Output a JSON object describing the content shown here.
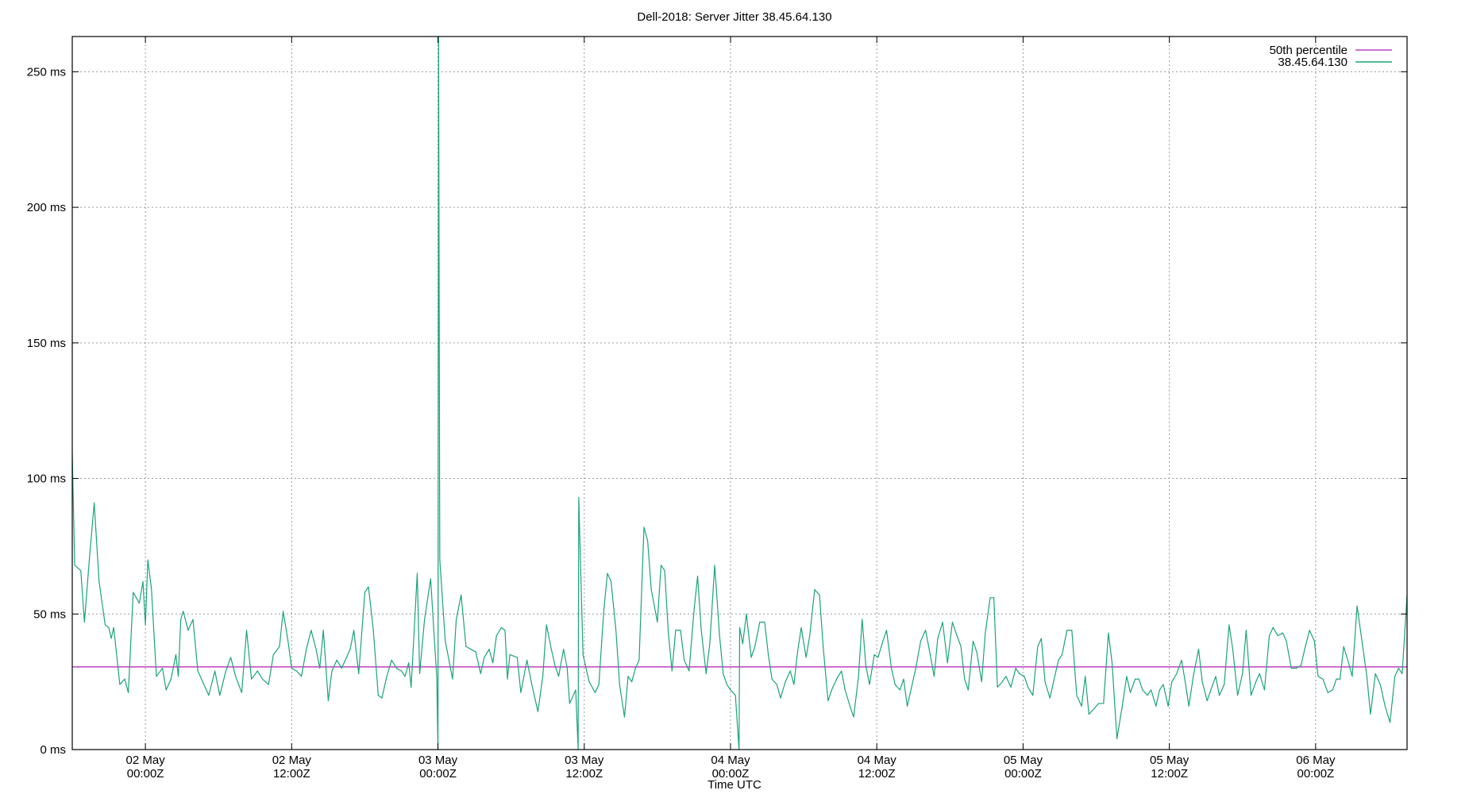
{
  "chart_data": {
    "type": "line",
    "title": "Dell-2018: Server Jitter 38.45.64.130",
    "xlabel": "Time UTC",
    "ylabel": "",
    "grid": true,
    "legend_position": "top-right",
    "x_unit": "hours since 01 May 18:00Z",
    "xlim": [
      0,
      109.5
    ],
    "ylim": [
      0,
      263
    ],
    "y_ticks": [
      {
        "value": 0,
        "label": "0 ms"
      },
      {
        "value": 50,
        "label": "50 ms"
      },
      {
        "value": 100,
        "label": "100 ms"
      },
      {
        "value": 150,
        "label": "150 ms"
      },
      {
        "value": 200,
        "label": "200 ms"
      },
      {
        "value": 250,
        "label": "250 ms"
      }
    ],
    "x_ticks": [
      {
        "value": 6,
        "line1": "02 May",
        "line2": "00:00Z"
      },
      {
        "value": 18,
        "line1": "02 May",
        "line2": "12:00Z"
      },
      {
        "value": 30,
        "line1": "03 May",
        "line2": "00:00Z"
      },
      {
        "value": 42,
        "line1": "03 May",
        "line2": "12:00Z"
      },
      {
        "value": 54,
        "line1": "04 May",
        "line2": "00:00Z"
      },
      {
        "value": 66,
        "line1": "04 May",
        "line2": "12:00Z"
      },
      {
        "value": 78,
        "line1": "05 May",
        "line2": "00:00Z"
      },
      {
        "value": 90,
        "line1": "05 May",
        "line2": "12:00Z"
      },
      {
        "value": 102,
        "line1": "06 May",
        "line2": "00:00Z"
      }
    ],
    "series": [
      {
        "name": "50th percentile",
        "color": "#c040c0",
        "kind": "hline",
        "value": 30.5
      },
      {
        "name": "38.45.64.130",
        "color": "#1aa37a",
        "kind": "line",
        "points": [
          [
            0.0,
            109
          ],
          [
            0.2,
            68
          ],
          [
            0.7,
            66
          ],
          [
            1.0,
            47
          ],
          [
            1.4,
            70
          ],
          [
            1.8,
            91
          ],
          [
            2.2,
            62
          ],
          [
            2.7,
            46
          ],
          [
            3.0,
            45
          ],
          [
            3.2,
            41
          ],
          [
            3.4,
            45
          ],
          [
            3.9,
            24
          ],
          [
            4.3,
            26
          ],
          [
            4.6,
            21
          ],
          [
            5.0,
            58
          ],
          [
            5.5,
            54
          ],
          [
            5.8,
            62
          ],
          [
            6.0,
            46
          ],
          [
            6.2,
            70
          ],
          [
            6.5,
            59
          ],
          [
            6.9,
            27
          ],
          [
            7.4,
            30
          ],
          [
            7.7,
            22
          ],
          [
            8.1,
            26
          ],
          [
            8.5,
            35
          ],
          [
            8.7,
            27
          ],
          [
            8.9,
            48
          ],
          [
            9.1,
            51
          ],
          [
            9.5,
            44
          ],
          [
            9.9,
            48
          ],
          [
            10.3,
            29
          ],
          [
            10.8,
            24
          ],
          [
            11.2,
            20
          ],
          [
            11.7,
            29
          ],
          [
            12.1,
            20
          ],
          [
            12.6,
            29
          ],
          [
            13.0,
            34
          ],
          [
            13.4,
            27
          ],
          [
            13.9,
            21
          ],
          [
            14.3,
            44
          ],
          [
            14.7,
            26
          ],
          [
            15.2,
            29
          ],
          [
            15.6,
            26
          ],
          [
            16.1,
            24
          ],
          [
            16.5,
            35
          ],
          [
            17.0,
            38
          ],
          [
            17.3,
            51
          ],
          [
            17.7,
            40
          ],
          [
            18.0,
            30
          ],
          [
            18.4,
            29
          ],
          [
            18.8,
            27
          ],
          [
            19.2,
            37
          ],
          [
            19.6,
            44
          ],
          [
            20.0,
            37
          ],
          [
            20.3,
            30
          ],
          [
            20.6,
            44
          ],
          [
            21.0,
            18
          ],
          [
            21.3,
            29
          ],
          [
            21.7,
            33
          ],
          [
            22.1,
            30
          ],
          [
            22.5,
            34
          ],
          [
            22.8,
            37
          ],
          [
            23.1,
            44
          ],
          [
            23.5,
            28
          ],
          [
            24.0,
            58
          ],
          [
            24.3,
            60
          ],
          [
            24.7,
            44
          ],
          [
            25.1,
            20
          ],
          [
            25.4,
            19
          ],
          [
            25.8,
            27
          ],
          [
            26.2,
            33
          ],
          [
            26.6,
            30
          ],
          [
            27.0,
            29
          ],
          [
            27.3,
            27
          ],
          [
            27.6,
            32
          ],
          [
            27.8,
            23
          ],
          [
            28.3,
            65
          ],
          [
            28.5,
            28
          ],
          [
            28.9,
            48
          ],
          [
            29.4,
            63
          ],
          [
            29.7,
            41
          ],
          [
            29.9,
            27
          ],
          [
            30.0,
            0
          ],
          [
            30.05,
            263
          ],
          [
            30.15,
            70
          ],
          [
            30.6,
            40
          ],
          [
            31.2,
            26
          ],
          [
            31.5,
            48
          ],
          [
            31.9,
            57
          ],
          [
            32.3,
            38
          ],
          [
            32.7,
            37
          ],
          [
            33.1,
            36
          ],
          [
            33.5,
            28
          ],
          [
            33.8,
            34
          ],
          [
            34.2,
            37
          ],
          [
            34.5,
            32
          ],
          [
            34.8,
            42
          ],
          [
            35.2,
            45
          ],
          [
            35.5,
            44
          ],
          [
            35.7,
            26
          ],
          [
            35.9,
            35
          ],
          [
            36.5,
            34
          ],
          [
            36.8,
            21
          ],
          [
            37.3,
            33
          ],
          [
            37.7,
            24
          ],
          [
            38.2,
            14
          ],
          [
            38.6,
            27
          ],
          [
            38.9,
            46
          ],
          [
            39.3,
            37
          ],
          [
            39.6,
            31
          ],
          [
            39.9,
            27
          ],
          [
            40.3,
            37
          ],
          [
            40.6,
            30
          ],
          [
            40.8,
            17
          ],
          [
            41.3,
            22
          ],
          [
            41.5,
            0
          ],
          [
            41.55,
            93
          ],
          [
            41.9,
            35
          ],
          [
            42.4,
            25
          ],
          [
            42.9,
            21
          ],
          [
            43.2,
            24
          ],
          [
            43.6,
            51
          ],
          [
            43.9,
            65
          ],
          [
            44.2,
            62
          ],
          [
            44.6,
            44
          ],
          [
            44.9,
            24
          ],
          [
            45.3,
            12
          ],
          [
            45.6,
            27
          ],
          [
            45.9,
            25
          ],
          [
            46.2,
            30
          ],
          [
            46.5,
            33
          ],
          [
            46.9,
            82
          ],
          [
            47.2,
            77
          ],
          [
            47.5,
            59
          ],
          [
            48.0,
            47
          ],
          [
            48.3,
            68
          ],
          [
            48.6,
            66
          ],
          [
            48.9,
            43
          ],
          [
            49.2,
            29
          ],
          [
            49.5,
            44
          ],
          [
            49.9,
            44
          ],
          [
            50.2,
            33
          ],
          [
            50.6,
            29
          ],
          [
            51.0,
            51
          ],
          [
            51.3,
            64
          ],
          [
            51.6,
            44
          ],
          [
            52.0,
            28
          ],
          [
            52.3,
            39
          ],
          [
            52.7,
            68
          ],
          [
            53.1,
            42
          ],
          [
            53.4,
            28
          ],
          [
            53.7,
            24
          ],
          [
            54.0,
            22
          ],
          [
            54.4,
            20
          ],
          [
            54.7,
            0
          ],
          [
            54.75,
            45
          ],
          [
            55.0,
            39
          ],
          [
            55.3,
            50
          ],
          [
            55.7,
            34
          ],
          [
            56.0,
            38
          ],
          [
            56.4,
            47
          ],
          [
            56.8,
            47
          ],
          [
            57.1,
            35
          ],
          [
            57.4,
            26
          ],
          [
            57.8,
            24
          ],
          [
            58.1,
            19
          ],
          [
            58.5,
            25
          ],
          [
            58.9,
            29
          ],
          [
            59.2,
            24
          ],
          [
            59.5,
            36
          ],
          [
            59.8,
            45
          ],
          [
            60.2,
            34
          ],
          [
            60.5,
            42
          ],
          [
            60.9,
            59
          ],
          [
            61.3,
            57
          ],
          [
            61.6,
            38
          ],
          [
            62.0,
            18
          ],
          [
            62.3,
            22
          ],
          [
            62.7,
            26
          ],
          [
            63.1,
            29
          ],
          [
            63.4,
            22
          ],
          [
            63.8,
            16
          ],
          [
            64.1,
            12
          ],
          [
            64.5,
            27
          ],
          [
            64.8,
            48
          ],
          [
            65.1,
            31
          ],
          [
            65.4,
            24
          ],
          [
            65.8,
            35
          ],
          [
            66.1,
            34
          ],
          [
            66.5,
            40
          ],
          [
            66.8,
            44
          ],
          [
            67.2,
            30
          ],
          [
            67.5,
            24
          ],
          [
            67.9,
            22
          ],
          [
            68.2,
            26
          ],
          [
            68.5,
            16
          ],
          [
            68.9,
            24
          ],
          [
            69.2,
            30
          ],
          [
            69.6,
            40
          ],
          [
            70.0,
            44
          ],
          [
            70.3,
            37
          ],
          [
            70.7,
            27
          ],
          [
            71.0,
            41
          ],
          [
            71.4,
            47
          ],
          [
            71.8,
            32
          ],
          [
            72.2,
            47
          ],
          [
            72.5,
            43
          ],
          [
            72.9,
            38
          ],
          [
            73.2,
            26
          ],
          [
            73.5,
            22
          ],
          [
            73.9,
            40
          ],
          [
            74.2,
            36
          ],
          [
            74.6,
            25
          ],
          [
            74.9,
            43
          ],
          [
            75.3,
            56
          ],
          [
            75.6,
            56
          ],
          [
            75.9,
            23
          ],
          [
            76.3,
            25
          ],
          [
            76.6,
            27
          ],
          [
            77.0,
            23
          ],
          [
            77.4,
            30
          ],
          [
            77.7,
            28
          ],
          [
            78.1,
            27
          ],
          [
            78.4,
            23
          ],
          [
            78.8,
            20
          ],
          [
            79.2,
            38
          ],
          [
            79.5,
            41
          ],
          [
            79.8,
            25
          ],
          [
            80.2,
            19
          ],
          [
            80.5,
            25
          ],
          [
            80.9,
            33
          ],
          [
            81.2,
            35
          ],
          [
            81.6,
            44
          ],
          [
            82.0,
            44
          ],
          [
            82.4,
            20
          ],
          [
            82.8,
            16
          ],
          [
            83.1,
            27
          ],
          [
            83.4,
            13
          ],
          [
            83.8,
            15
          ],
          [
            84.2,
            17
          ],
          [
            84.6,
            17
          ],
          [
            85.0,
            43
          ],
          [
            85.3,
            32
          ],
          [
            85.7,
            4
          ],
          [
            86.1,
            15
          ],
          [
            86.5,
            27
          ],
          [
            86.8,
            21
          ],
          [
            87.2,
            26
          ],
          [
            87.5,
            26
          ],
          [
            87.8,
            22
          ],
          [
            88.2,
            20
          ],
          [
            88.5,
            22
          ],
          [
            88.9,
            16
          ],
          [
            89.2,
            22
          ],
          [
            89.5,
            24
          ],
          [
            89.9,
            16
          ],
          [
            90.2,
            25
          ],
          [
            90.6,
            28
          ],
          [
            91.0,
            33
          ],
          [
            91.3,
            25
          ],
          [
            91.6,
            16
          ],
          [
            92.0,
            28
          ],
          [
            92.4,
            37
          ],
          [
            92.7,
            25
          ],
          [
            93.1,
            18
          ],
          [
            93.4,
            22
          ],
          [
            93.8,
            27
          ],
          [
            94.1,
            20
          ],
          [
            94.5,
            24
          ],
          [
            94.9,
            46
          ],
          [
            95.2,
            37
          ],
          [
            95.6,
            20
          ],
          [
            96.0,
            28
          ],
          [
            96.3,
            44
          ],
          [
            96.7,
            20
          ],
          [
            97.1,
            25
          ],
          [
            97.4,
            28
          ],
          [
            97.8,
            22
          ],
          [
            98.2,
            42
          ],
          [
            98.5,
            45
          ],
          [
            98.9,
            42
          ],
          [
            99.3,
            43
          ],
          [
            99.6,
            40
          ],
          [
            100.0,
            30
          ],
          [
            100.4,
            30
          ],
          [
            100.8,
            31
          ],
          [
            101.1,
            37
          ],
          [
            101.5,
            44
          ],
          [
            101.9,
            40
          ],
          [
            102.2,
            27
          ],
          [
            102.6,
            26
          ],
          [
            103.0,
            21
          ],
          [
            103.4,
            22
          ],
          [
            103.7,
            26
          ],
          [
            104.0,
            26
          ],
          [
            104.3,
            38
          ],
          [
            104.7,
            32
          ],
          [
            105.0,
            27
          ],
          [
            105.4,
            53
          ],
          [
            105.8,
            40
          ],
          [
            106.2,
            27
          ],
          [
            106.5,
            13
          ],
          [
            106.9,
            28
          ],
          [
            107.3,
            24
          ],
          [
            107.7,
            16
          ],
          [
            108.1,
            10
          ],
          [
            108.5,
            27
          ],
          [
            108.8,
            30
          ],
          [
            109.1,
            28
          ],
          [
            109.5,
            57
          ]
        ]
      }
    ]
  }
}
